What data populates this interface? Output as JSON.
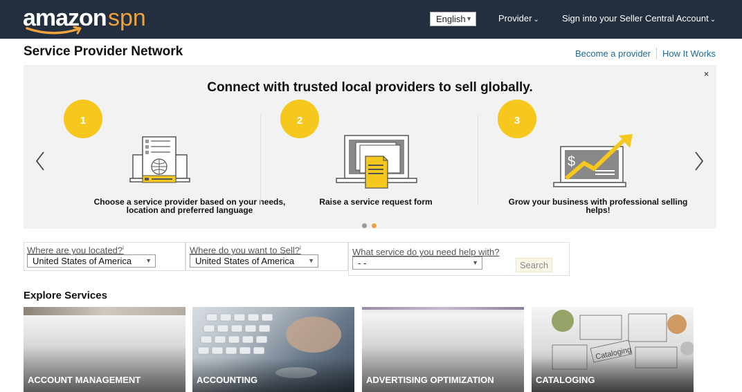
{
  "header": {
    "logo_main": "amazon",
    "logo_sub": "spn",
    "language": "English",
    "nav": [
      {
        "label": "Provider"
      },
      {
        "label": "Sign into your Seller Central Account"
      }
    ]
  },
  "title_row": {
    "page_title": "Service Provider Network",
    "links": [
      {
        "label": "Become a provider"
      },
      {
        "label": "How It Works"
      }
    ]
  },
  "carousel": {
    "headline": "Connect with trusted local providers to sell globally.",
    "close_glyph": "×",
    "steps": [
      {
        "number": "1",
        "caption_lines": [
          "Choose a service provider based on your needs,",
          "location and preferred language"
        ],
        "icon": "provider-document-icon"
      },
      {
        "number": "2",
        "caption_lines": [
          "Raise a service request form"
        ],
        "icon": "request-form-icon"
      },
      {
        "number": "3",
        "caption_lines": [
          "Grow your business with professional selling",
          "helps!"
        ],
        "icon": "growth-chart-icon"
      }
    ],
    "dots": {
      "count": 2,
      "active_index": 1
    },
    "colors": {
      "accent": "#f6c71c",
      "dot_active": "#e8a33c",
      "dot_inactive": "#999999"
    }
  },
  "search": {
    "location": {
      "label": "Where are you located?",
      "info": "i",
      "value": "United States of America"
    },
    "sell": {
      "label": "Where do you want to Sell?",
      "info": "i",
      "value": "United States of America"
    },
    "service": {
      "label": "What service do you need help with?",
      "value": "- -"
    },
    "button": "Search"
  },
  "explore": {
    "title": "Explore Services",
    "cards": [
      {
        "label": "ACCOUNT MANAGEMENT"
      },
      {
        "label": "ACCOUNTING"
      },
      {
        "label": "ADVERTISING OPTIMIZATION"
      },
      {
        "label": "CATALOGING"
      }
    ]
  },
  "colors": {
    "header_bg": "#232f3e",
    "logo_orange": "#f0a23b",
    "link": "#1d6a96"
  }
}
